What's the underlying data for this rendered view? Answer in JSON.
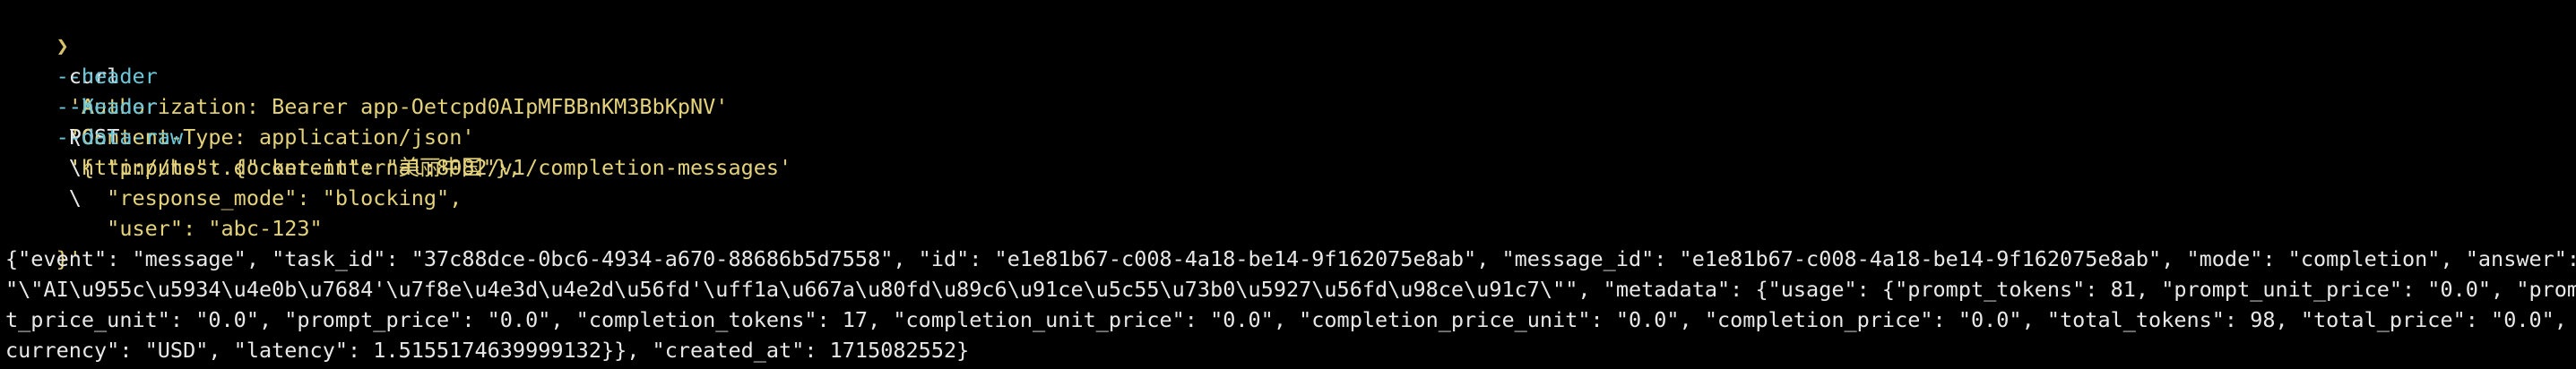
{
  "terminal": {
    "prompt_symbol": "❯",
    "lines": [
      {
        "cmd": "curl",
        "opt": "-X",
        "method": "POST",
        "url": "'http://host.docker.internal:8082/v1/completion-messages'",
        "cont": "\\"
      },
      {
        "opt": "--header",
        "str": "'Authorization: Bearer app-Oetcpd0AIpMFBBnKM3BbKpNV'",
        "cont": "\\"
      },
      {
        "opt": "--header",
        "str": "'Content-Type: application/json'",
        "cont": "\\"
      },
      {
        "opt": "--data-raw",
        "str": "'{"
      },
      {
        "str": "    \"inputs\": {\"content\": \"美丽中国\"},"
      },
      {
        "str": "    \"response_mode\": \"blocking\","
      },
      {
        "str": "    \"user\": \"abc-123\""
      },
      {
        "str": "}'"
      }
    ],
    "output_lines": [
      "{\"event\": \"message\", \"task_id\": \"37c88dce-0bc6-4934-a670-88686b5d7558\", \"id\": \"e1e81b67-c008-4a18-be14-9f162075e8ab\", \"message_id\": \"e1e81b67-c008-4a18-be14-9f162075e8ab\", \"mode\": \"completion\", \"answer\":",
      "\"\\\"AI\\u955c\\u5934\\u4e0b\\u7684'\\u7f8e\\u4e3d\\u4e2d\\u56fd'\\uff1a\\u667a\\u80fd\\u89c6\\u91ce\\u5c55\\u73b0\\u5927\\u56fd\\u98ce\\u91c7\\\"\", \"metadata\": {\"usage\": {\"prompt_tokens\": 81, \"prompt_unit_price\": \"0.0\", \"promp",
      "t_price_unit\": \"0.0\", \"prompt_price\": \"0.0\", \"completion_tokens\": 17, \"completion_unit_price\": \"0.0\", \"completion_price_unit\": \"0.0\", \"completion_price\": \"0.0\", \"total_tokens\": 98, \"total_price\": \"0.0\", \"",
      "currency\": \"USD\", \"latency\": 1.5155174639999132}}, \"created_at\": 1715082552}"
    ]
  }
}
